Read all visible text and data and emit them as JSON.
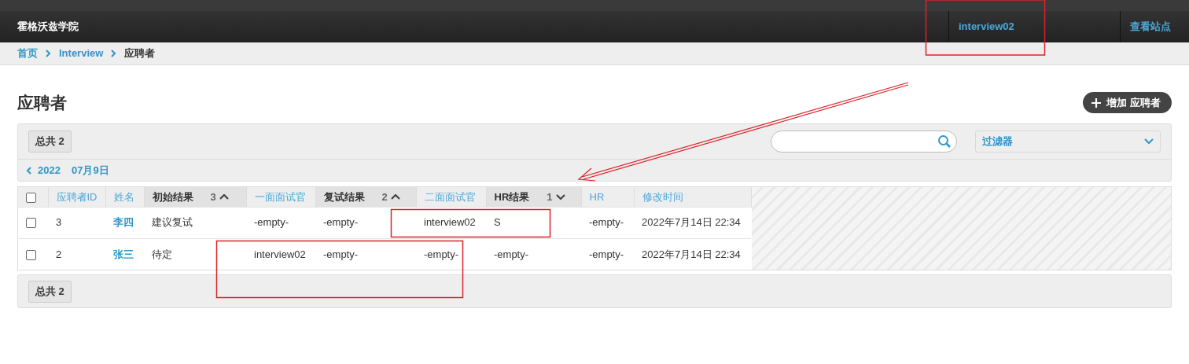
{
  "header": {
    "site_title": "霍格沃兹学院",
    "user": "interview02",
    "view_site": "查看站点"
  },
  "breadcrumb": [
    {
      "label": "首页",
      "link": true
    },
    {
      "label": "Interview",
      "link": true
    },
    {
      "label": "应聘者",
      "link": false
    }
  ],
  "page_title": "应聘者",
  "add_button": "增加 应聘者",
  "toolbar": {
    "count": "总共 2",
    "filter": "过滤器"
  },
  "date_nav": {
    "back": "2022",
    "current": "07月9日"
  },
  "table": {
    "select_all_checked": false,
    "columns": [
      {
        "label": "应聘者ID",
        "sorted": false
      },
      {
        "label": "姓名",
        "sorted": false
      },
      {
        "label": "初始结果",
        "sorted": true,
        "priority": "3",
        "descending": false
      },
      {
        "label": "一面面试官",
        "sorted": false
      },
      {
        "label": "复试结果",
        "sorted": true,
        "priority": "2",
        "descending": false
      },
      {
        "label": "二面面试官",
        "sorted": false
      },
      {
        "label": "HR结果",
        "sorted": true,
        "priority": "1",
        "descending": true
      },
      {
        "label": "HR",
        "sorted": false
      },
      {
        "label": "修改时间",
        "sorted": false
      }
    ],
    "rows": [
      {
        "checked": false,
        "cells": [
          "3",
          "李四",
          "建议复试",
          "-empty-",
          "-empty-",
          "interview02",
          "S",
          "-empty-",
          "2022年7月14日 22:34"
        ]
      },
      {
        "checked": false,
        "cells": [
          "2",
          "张三",
          "待定",
          "interview02",
          "-empty-",
          "-empty-",
          "-empty-",
          "-empty-",
          "2022年7月14日 22:34"
        ]
      }
    ]
  },
  "footer_count": "总共 2"
}
